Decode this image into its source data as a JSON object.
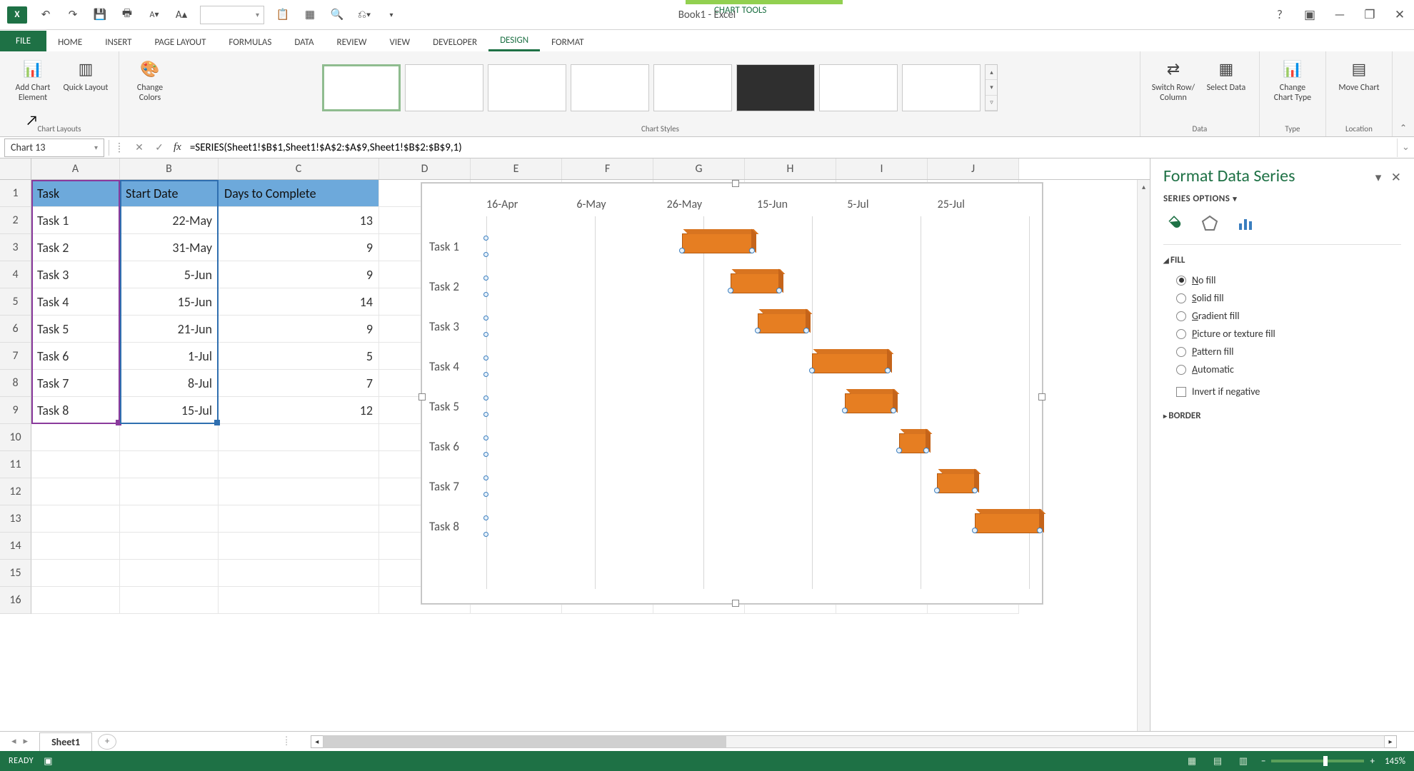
{
  "app_title": "Book1 - Excel",
  "chart_tools_label": "CHART TOOLS",
  "tabs": [
    "FILE",
    "HOME",
    "INSERT",
    "PAGE LAYOUT",
    "FORMULAS",
    "DATA",
    "REVIEW",
    "VIEW",
    "DEVELOPER",
    "DESIGN",
    "FORMAT"
  ],
  "active_tab": "DESIGN",
  "ribbon": {
    "groups": [
      "Chart Layouts",
      "Chart Styles",
      "Data",
      "Type",
      "Location"
    ],
    "add_chart_element": "Add Chart Element",
    "quick_layout": "Quick Layout",
    "change_colors": "Change Colors",
    "switch_row_col": "Switch Row/ Column",
    "select_data": "Select Data",
    "change_chart_type": "Change Chart Type",
    "move_chart": "Move Chart"
  },
  "namebox": "Chart 13",
  "formula": "=SERIES(Sheet1!$B$1,Sheet1!$A$2:$A$9,Sheet1!$B$2:$B$9,1)",
  "columns": [
    "A",
    "B",
    "C",
    "D",
    "E",
    "F",
    "G",
    "H",
    "I",
    "J"
  ],
  "rows_visible": 16,
  "table": {
    "headers": [
      "Task",
      "Start Date",
      "Days to Complete"
    ],
    "data": [
      [
        "Task 1",
        "22-May",
        "13"
      ],
      [
        "Task 2",
        "31-May",
        "9"
      ],
      [
        "Task 3",
        "5-Jun",
        "9"
      ],
      [
        "Task 4",
        "15-Jun",
        "14"
      ],
      [
        "Task 5",
        "21-Jun",
        "9"
      ],
      [
        "Task 6",
        "1-Jul",
        "5"
      ],
      [
        "Task 7",
        "8-Jul",
        "7"
      ],
      [
        "Task 8",
        "15-Jul",
        "12"
      ]
    ]
  },
  "chart_data": {
    "type": "bar",
    "orientation": "horizontal_stacked_gantt",
    "title": "",
    "x_axis_labels": [
      "16-Apr",
      "6-May",
      "26-May",
      "15-Jun",
      "5-Jul",
      "25-Jul"
    ],
    "series": [
      {
        "name": "Start Date",
        "role": "offset",
        "values": [
          "22-May",
          "31-May",
          "5-Jun",
          "15-Jun",
          "21-Jun",
          "1-Jul",
          "8-Jul",
          "15-Jul"
        ]
      },
      {
        "name": "Days to Complete",
        "role": "duration",
        "values": [
          13,
          9,
          9,
          14,
          9,
          5,
          7,
          12
        ]
      }
    ],
    "categories": [
      "Task 1",
      "Task 2",
      "Task 3",
      "Task 4",
      "Task 5",
      "Task 6",
      "Task 7",
      "Task 8"
    ]
  },
  "format_pane": {
    "title": "Format Data Series",
    "series_options": "SERIES OPTIONS",
    "fill": "FILL",
    "border": "BORDER",
    "options": [
      "No fill",
      "Solid fill",
      "Gradient fill",
      "Picture or texture fill",
      "Pattern fill",
      "Automatic"
    ],
    "selected": "No fill",
    "invert": "Invert if negative"
  },
  "sheet_tab": "Sheet1",
  "status": "READY",
  "zoom": "145%"
}
